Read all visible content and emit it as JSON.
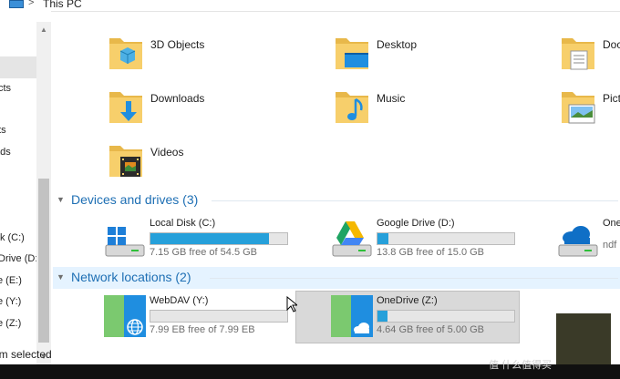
{
  "breadcrumb": {
    "chevron": ">",
    "location": "This PC"
  },
  "nav": {
    "labels": [
      "cts",
      "nts",
      "ads",
      "isk (C:)",
      "Drive (D:",
      "e (E:)",
      "e (Y:)",
      "e (Z:)"
    ]
  },
  "status": {
    "text": "item selected"
  },
  "folders": [
    {
      "name": "3D Objects",
      "icon": "3d-objects-folder-icon"
    },
    {
      "name": "Desktop",
      "icon": "desktop-folder-icon"
    },
    {
      "name": "Doc",
      "icon": "documents-folder-icon"
    },
    {
      "name": "Downloads",
      "icon": "downloads-folder-icon"
    },
    {
      "name": "Music",
      "icon": "music-folder-icon"
    },
    {
      "name": "Pict",
      "icon": "pictures-folder-icon"
    },
    {
      "name": "Videos",
      "icon": "videos-folder-icon"
    }
  ],
  "devices_section": {
    "title": "Devices and drives (3)"
  },
  "drives": [
    {
      "name": "Local Disk (C:)",
      "free": "7.15 GB free of 54.5 GB",
      "used_fraction": 0.869,
      "icon": "windows-disk-icon"
    },
    {
      "name": "Google Drive (D:)",
      "free": "13.8 GB free of 15.0 GB",
      "used_fraction": 0.08,
      "icon": "google-drive-icon"
    },
    {
      "name": "One",
      "free": "ndf",
      "icon": "onedrive-disk-icon"
    }
  ],
  "network_section": {
    "title": "Network locations (2)"
  },
  "network": [
    {
      "name": "WebDAV (Y:)",
      "free": "7.99 EB free of 7.99 EB",
      "used_fraction": 0.0,
      "icon": "webdav-globe-icon"
    },
    {
      "name": "OneDrive (Z:)",
      "free": "4.64 GB free of 5.00 GB",
      "used_fraction": 0.072,
      "icon": "onedrive-cloud-icon"
    }
  ],
  "watermark": {
    "text": "值 什么值得买"
  },
  "colors": {
    "accent": "#26a0da",
    "section": "#1e6fb4",
    "folder": "#f5c55a",
    "nav_selected": "#e5e5e5"
  }
}
